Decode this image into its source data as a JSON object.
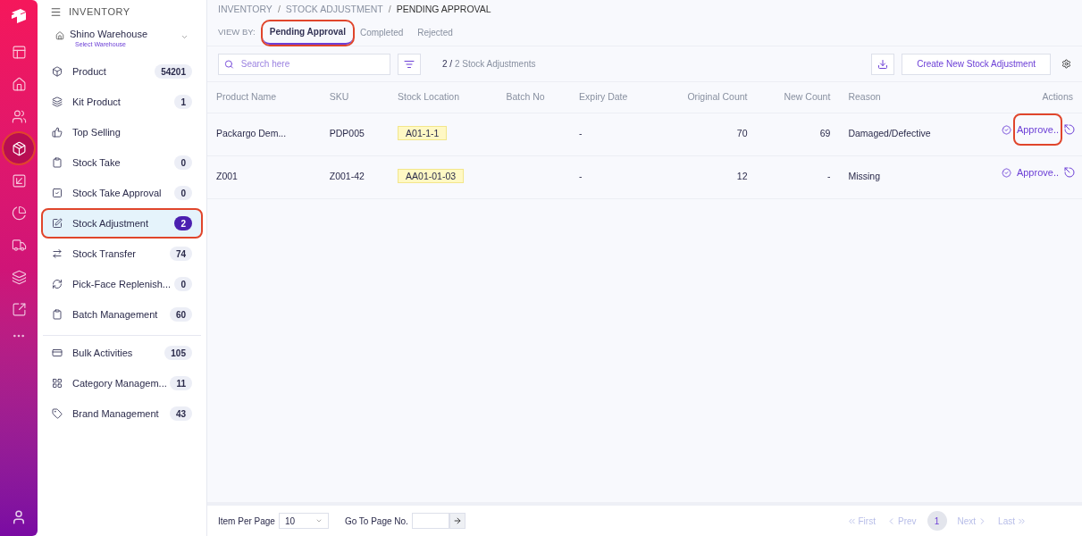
{
  "rail": {
    "items": [
      {
        "selected": false,
        "highlighted": false
      },
      {
        "selected": false,
        "highlighted": false
      },
      {
        "selected": false,
        "highlighted": false
      },
      {
        "selected": true,
        "highlighted": true
      },
      {
        "selected": false,
        "highlighted": false
      },
      {
        "selected": false,
        "highlighted": false
      },
      {
        "selected": false,
        "highlighted": false
      },
      {
        "selected": false,
        "highlighted": false
      },
      {
        "selected": false,
        "highlighted": false
      }
    ]
  },
  "sidebar": {
    "title": "INVENTORY",
    "warehouse": {
      "name": "Shino Warehouse",
      "hint": "Select Warehouse"
    },
    "groups": [
      [
        {
          "label": "Product",
          "count": "54201",
          "selected": false,
          "highlighted": false
        },
        {
          "label": "Kit Product",
          "count": "1",
          "selected": false,
          "highlighted": false
        },
        {
          "label": "Top Selling",
          "selected": false,
          "highlighted": false
        },
        {
          "label": "Stock Take",
          "count": "0",
          "selected": false,
          "highlighted": false
        },
        {
          "label": "Stock Take Approval",
          "count": "0",
          "selected": false,
          "highlighted": false
        },
        {
          "label": "Stock Adjustment",
          "count": "2",
          "selected": true,
          "highlighted": true
        },
        {
          "label": "Stock Transfer",
          "count": "74",
          "selected": false,
          "highlighted": false
        },
        {
          "label": "Pick-Face Replenish...",
          "count": "0",
          "selected": false,
          "highlighted": false
        },
        {
          "label": "Batch Management",
          "count": "60",
          "selected": false,
          "highlighted": false
        }
      ],
      [
        {
          "label": "Bulk Activities",
          "count": "105",
          "selected": false,
          "highlighted": false
        },
        {
          "label": "Category Managem...",
          "count": "11",
          "selected": false,
          "highlighted": false
        },
        {
          "label": "Brand Management",
          "count": "43",
          "selected": false,
          "highlighted": false
        }
      ]
    ]
  },
  "breadcrumb": {
    "separator": "/",
    "items": [
      "INVENTORY",
      "STOCK ADJUSTMENT",
      "PENDING APPROVAL"
    ]
  },
  "view_by": {
    "label": "VIEW BY:",
    "tabs": [
      {
        "label": "Pending Approval",
        "selected": true,
        "highlighted": true
      },
      {
        "label": "Completed",
        "selected": false,
        "highlighted": false
      },
      {
        "label": "Rejected",
        "selected": false,
        "highlighted": false
      }
    ]
  },
  "toolbar": {
    "search": {
      "placeholder": "Search here"
    },
    "count_current": "2",
    "count_separator": "/",
    "count_total": "2 Stock Adjustments",
    "create_button": "Create New Stock Adjustment"
  },
  "table": {
    "columns": [
      "Product Name",
      "SKU",
      "Stock Location",
      "Batch No",
      "Expiry Date",
      "Original Count",
      "New Count",
      "Reason",
      "Actions"
    ],
    "rows": [
      {
        "cells": [
          "Packargo Dem...",
          "PDP005",
          "A01-1-1",
          "",
          "-",
          "70",
          "69",
          "Damaged/Defective"
        ],
        "action": "Approve..",
        "action_highlighted": true
      },
      {
        "cells": [
          "Z001",
          "Z001-42",
          "AA01-01-03",
          "",
          "-",
          "12",
          "-",
          "Missing"
        ],
        "action": "Approve..",
        "action_highlighted": false
      }
    ]
  },
  "footer": {
    "per_page_label": "Item Per Page",
    "per_page": "10",
    "goto_label": "Go To Page No.",
    "pager": [
      {
        "label": "First",
        "kind": "first",
        "disabled": true
      },
      {
        "label": "Prev",
        "kind": "prev",
        "disabled": true
      },
      {
        "label": "1",
        "kind": "page",
        "selected": true
      },
      {
        "label": "Next",
        "kind": "next",
        "disabled": true
      },
      {
        "label": "Last",
        "kind": "last",
        "disabled": true
      }
    ]
  }
}
